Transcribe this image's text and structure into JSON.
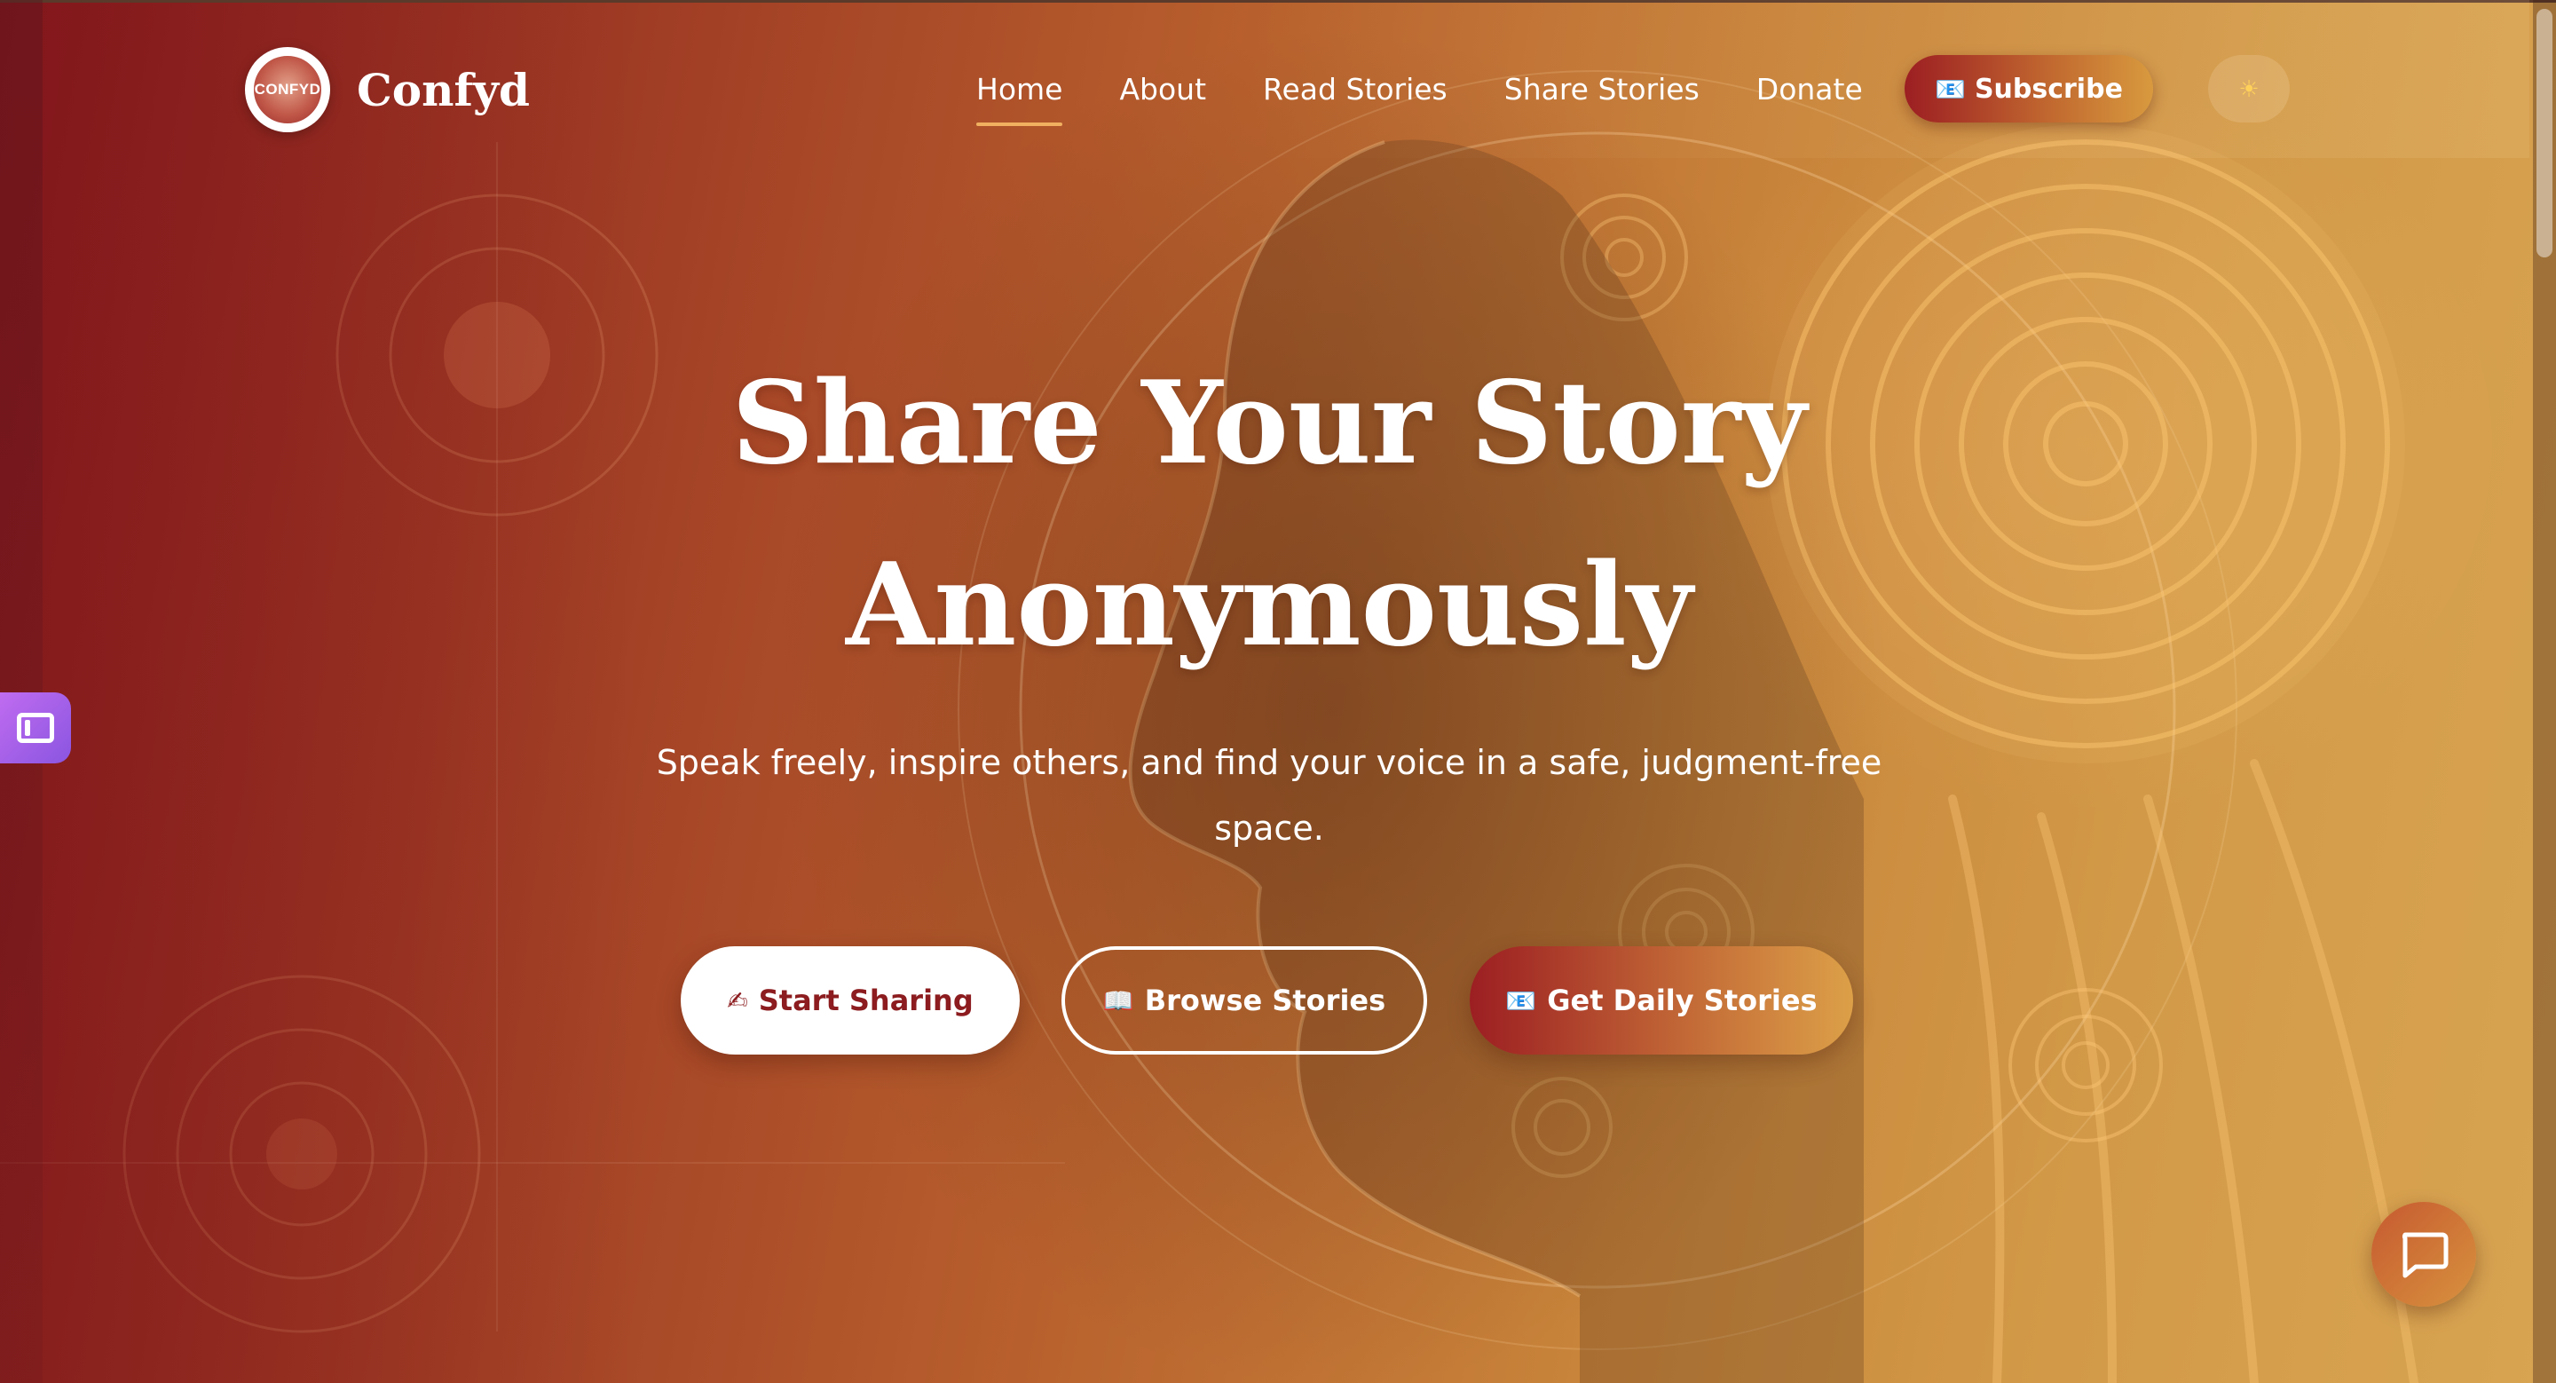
{
  "brand": {
    "logo_text": "CONFYD",
    "name": "Confyd"
  },
  "nav": {
    "items": [
      {
        "label": "Home",
        "active": true
      },
      {
        "label": "About",
        "active": false
      },
      {
        "label": "Read Stories",
        "active": false
      },
      {
        "label": "Share Stories",
        "active": false
      },
      {
        "label": "Donate",
        "active": false
      }
    ],
    "subscribe_label": "Subscribe",
    "subscribe_icon": "📧",
    "theme_icon": "☀"
  },
  "hero": {
    "title_line1": "Share Your Story",
    "title_line2": "Anonymously",
    "subtitle": "Speak freely, inspire others, and find your voice in a safe, judgment-free space."
  },
  "cta": {
    "start_icon": "✍",
    "start_label": "Start Sharing",
    "browse_icon": "📖",
    "browse_label": "Browse Stories",
    "daily_icon": "📧",
    "daily_label": "Get Daily Stories"
  },
  "icons": {
    "side_widget": "sidebar-panel-icon",
    "chat": "chat-bubble-icon",
    "theme": "sun-icon"
  },
  "colors": {
    "brand_red": "#8c1c1f",
    "accent_gold": "#d89a3e",
    "text": "#ffffff"
  }
}
